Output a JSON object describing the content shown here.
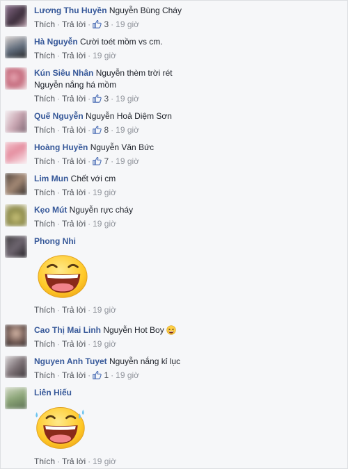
{
  "comments": [
    {
      "name": "Lương Thu Huyền",
      "text": "Nguyễn Bùng Cháy",
      "like_label": "Thích",
      "reply_label": "Trả lời",
      "likes": "3",
      "time": "19 giờ"
    },
    {
      "name": "Hà Nguyễn",
      "text": "Cười toét mồm vs cm.",
      "like_label": "Thích",
      "reply_label": "Trả lời",
      "time": "19 giờ"
    },
    {
      "name": "Kún Siêu Nhân",
      "text": "Nguyễn thèm trời rét",
      "text2": "Nguyễn nắng há mồm",
      "like_label": "Thích",
      "reply_label": "Trả lời",
      "likes": "3",
      "time": "19 giờ"
    },
    {
      "name": "Quế Nguyễn",
      "text": "Nguyễn Hoả Diệm Sơn",
      "like_label": "Thích",
      "reply_label": "Trả lời",
      "likes": "8",
      "time": "19 giờ"
    },
    {
      "name": "Hoàng Huyền",
      "text": "Nguyễn Văn Bức",
      "like_label": "Thích",
      "reply_label": "Trả lời",
      "likes": "7",
      "time": "19 giờ"
    },
    {
      "name": "Lim Mun",
      "text": "Chết với cm",
      "like_label": "Thích",
      "reply_label": "Trả lời",
      "time": "19 giờ"
    },
    {
      "name": "Kẹo Mút",
      "text": "Nguyễn rực cháy",
      "like_label": "Thích",
      "reply_label": "Trả lời",
      "time": "19 giờ"
    },
    {
      "name": "Phong Nhi",
      "sticker": "grinning-sticker",
      "like_label": "Thích",
      "reply_label": "Trả lời",
      "time": "19 giờ"
    },
    {
      "name": "Cao Thị Mai Linh",
      "text": "Nguyễn Hot Boy",
      "emoji": "laughing-emoji",
      "like_label": "Thích",
      "reply_label": "Trả lời",
      "time": "19 giờ"
    },
    {
      "name": "Nguyen Anh Tuyet",
      "text": "Nguyễn nắng kỉ lục",
      "like_label": "Thích",
      "reply_label": "Trả lời",
      "likes": "1",
      "time": "19 giờ"
    },
    {
      "name": "Liên Hiếu",
      "sticker": "tears-of-joy-sticker",
      "like_label": "Thích",
      "reply_label": "Trả lời",
      "time": "19 giờ"
    }
  ],
  "colors": {
    "name_link": "#365899",
    "action_link": "#4b4f56",
    "meta_text": "#90949c",
    "background": "#f6f7f9"
  }
}
